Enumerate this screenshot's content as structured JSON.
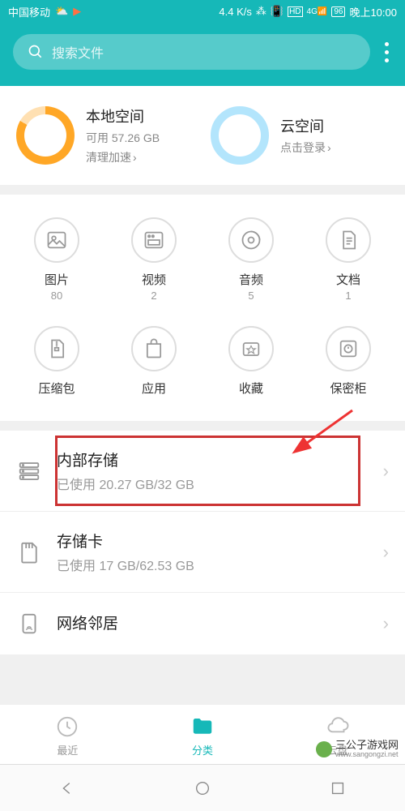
{
  "status": {
    "carrier": "中国移动",
    "speed": "4.4 K/s",
    "battery": "96",
    "time": "晚上10:00"
  },
  "search": {
    "placeholder": "搜索文件"
  },
  "storage_cards": {
    "local": {
      "title": "本地空间",
      "subtitle": "可用 57.26 GB",
      "action": "清理加速"
    },
    "cloud": {
      "title": "云空间",
      "action": "点击登录"
    }
  },
  "categories": [
    {
      "label": "图片",
      "count": "80",
      "icon": "image"
    },
    {
      "label": "视频",
      "count": "2",
      "icon": "video"
    },
    {
      "label": "音频",
      "count": "5",
      "icon": "audio"
    },
    {
      "label": "文档",
      "count": "1",
      "icon": "doc"
    },
    {
      "label": "压缩包",
      "count": "",
      "icon": "zip"
    },
    {
      "label": "应用",
      "count": "",
      "icon": "app"
    },
    {
      "label": "收藏",
      "count": "",
      "icon": "fav"
    },
    {
      "label": "保密柜",
      "count": "",
      "icon": "safe"
    }
  ],
  "storage_list": [
    {
      "title": "内部存储",
      "sub": "已使用 20.27 GB/32 GB",
      "highlighted": true
    },
    {
      "title": "存储卡",
      "sub": "已使用 17 GB/62.53 GB"
    },
    {
      "title": "网络邻居",
      "sub": ""
    }
  ],
  "tabs": [
    {
      "label": "最近",
      "active": false
    },
    {
      "label": "分类",
      "active": true
    },
    {
      "label": "云盘",
      "active": false
    }
  ],
  "watermark": {
    "text": "三公子游戏网",
    "url": "www.sangongzi.net"
  }
}
